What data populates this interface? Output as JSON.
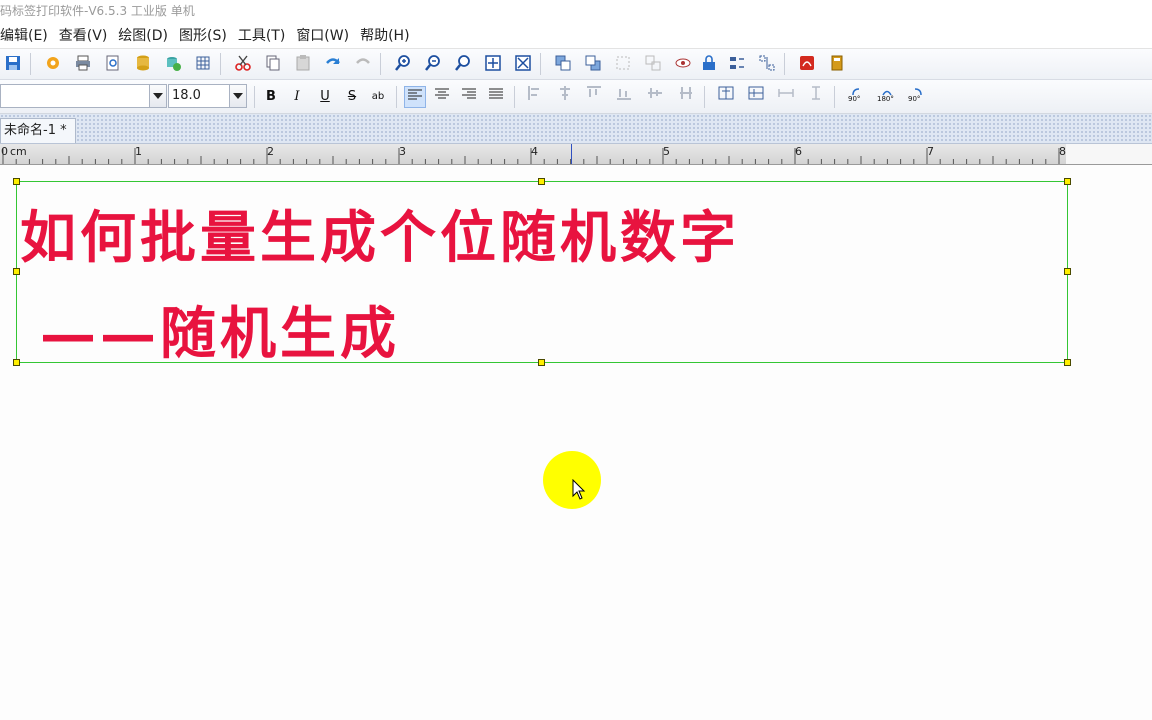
{
  "window": {
    "title": "码标签打印软件-V6.5.3 工业版 单机"
  },
  "menu": [
    "编辑(E)",
    "查看(V)",
    "绘图(D)",
    "图形(S)",
    "工具(T)",
    "窗口(W)",
    "帮助(H)"
  ],
  "toolbar1": {
    "icons": [
      "save-icon",
      "settings-gear-icon",
      "print-icon",
      "print-preview-icon",
      "database-icon",
      "database-connect-icon",
      "grid-icon",
      "cut-icon",
      "copy-icon",
      "paste-icon",
      "undo-icon",
      "redo-icon",
      "zoom-in-icon",
      "zoom-out-icon",
      "zoom-actual-icon",
      "fit-page-icon",
      "fit-width-icon",
      "bring-forward-icon",
      "send-backward-icon",
      "group-icon",
      "ungroup-icon",
      "visibility-icon",
      "lock-icon",
      "distribute-icon",
      "align-icon",
      "pdf-icon",
      "calculator-icon"
    ]
  },
  "toolbar2": {
    "font_name": "",
    "font_size": "18.0",
    "bold": "B",
    "italic": "I",
    "underline": "U",
    "strikethrough": "S",
    "char_spacing": "ab",
    "rotate_left_label": "90°",
    "rotate_180_label": "180°",
    "rotate_right_label": "90°"
  },
  "tabs": [
    {
      "label": "未命名-1 *"
    }
  ],
  "ruler": {
    "unit": "cm",
    "labels": [
      "0",
      "1",
      "2",
      "3",
      "4",
      "5",
      "6",
      "7",
      "8"
    ]
  },
  "canvas": {
    "text_line1": "如何批量生成个位随机数字",
    "text_line2": "——随机生成",
    "text_color": "#e8133f",
    "selection_color": "#34c634",
    "handle_color": "#ffef00"
  },
  "cursor": {
    "highlight_color": "#ffff00"
  }
}
